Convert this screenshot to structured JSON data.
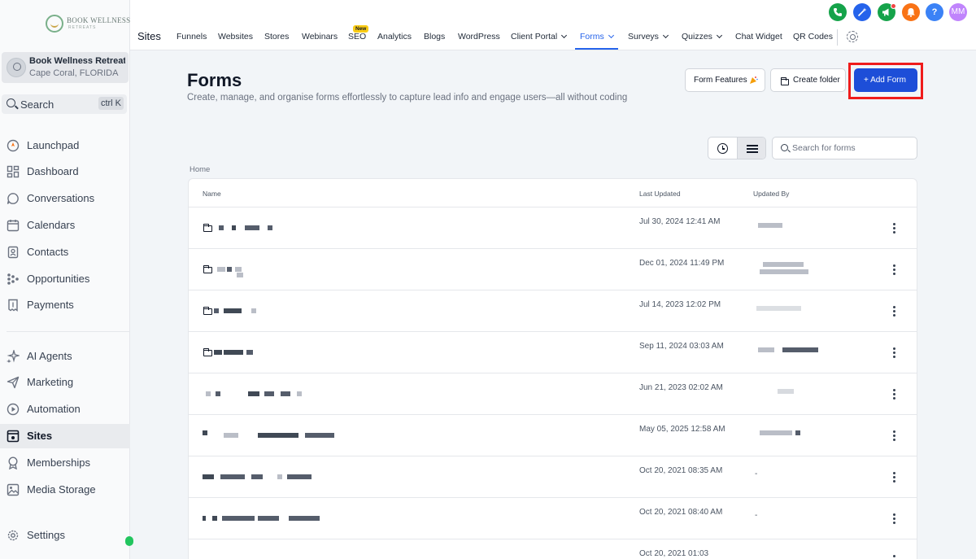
{
  "brand": {
    "logo_line1": "BOOK WELLNESS",
    "logo_line2": "RETREATS"
  },
  "account": {
    "name": "Book Wellness Retreats",
    "location": "Cape Coral, FLORIDA"
  },
  "sidebar_search": {
    "label": "Search",
    "shortcut": "ctrl K"
  },
  "sidebar": {
    "items": [
      {
        "id": "launchpad",
        "label": "Launchpad"
      },
      {
        "id": "dashboard",
        "label": "Dashboard"
      },
      {
        "id": "conversations",
        "label": "Conversations"
      },
      {
        "id": "calendars",
        "label": "Calendars"
      },
      {
        "id": "contacts",
        "label": "Contacts"
      },
      {
        "id": "opportunities",
        "label": "Opportunities"
      },
      {
        "id": "payments",
        "label": "Payments"
      },
      {
        "id": "ai-agents",
        "label": "AI Agents"
      },
      {
        "id": "marketing",
        "label": "Marketing"
      },
      {
        "id": "automation",
        "label": "Automation"
      },
      {
        "id": "sites",
        "label": "Sites",
        "active": true
      },
      {
        "id": "memberships",
        "label": "Memberships"
      },
      {
        "id": "media-storage",
        "label": "Media Storage"
      },
      {
        "id": "settings",
        "label": "Settings"
      }
    ]
  },
  "topnav": {
    "section_title": "Sites",
    "tabs": [
      {
        "label": "Funnels"
      },
      {
        "label": "Websites"
      },
      {
        "label": "Stores"
      },
      {
        "label": "Webinars"
      },
      {
        "label": "SEO",
        "badge": "New"
      },
      {
        "label": "Analytics"
      },
      {
        "label": "Blogs"
      },
      {
        "label": "WordPress"
      },
      {
        "label": "Client Portal",
        "dropdown": true
      },
      {
        "label": "Forms",
        "dropdown": true,
        "active": true
      },
      {
        "label": "Surveys",
        "dropdown": true
      },
      {
        "label": "Quizzes",
        "dropdown": true
      },
      {
        "label": "Chat Widget"
      },
      {
        "label": "QR Codes"
      }
    ],
    "seo_badge": "New"
  },
  "header_icons": {
    "phone_color": "#15a34a",
    "magic_color": "#2563eb",
    "announce_color": "#16a34a",
    "bell_color": "#f97316",
    "help_label": "?",
    "help_color": "#3b82f6",
    "avatar_initials": "MM",
    "avatar_color": "#c084fc"
  },
  "page": {
    "title": "Forms",
    "subtitle": "Create, manage, and organise forms effortlessly to capture lead info and engage users—all without coding",
    "buttons": {
      "form_features": "Form Features",
      "create_folder": "Create folder",
      "add_form": "+ Add Form"
    },
    "search_placeholder": "Search for forms",
    "breadcrumb": "Home"
  },
  "table": {
    "columns": {
      "name": "Name",
      "last_updated": "Last Updated",
      "updated_by": "Updated By"
    },
    "rows": [
      {
        "type": "folder",
        "last_updated": "Jul 30, 2024 12:41 AM",
        "updated_by": ""
      },
      {
        "type": "folder",
        "last_updated": "Dec 01, 2024 11:49 PM",
        "updated_by": ""
      },
      {
        "type": "folder",
        "last_updated": "Jul 14, 2023 12:02 PM",
        "updated_by": ""
      },
      {
        "type": "folder",
        "last_updated": "Sep 11, 2024 03:03 AM",
        "updated_by": ""
      },
      {
        "type": "form",
        "last_updated": "Jun 21, 2023 02:02 AM",
        "updated_by": ""
      },
      {
        "type": "form",
        "last_updated": "May 05, 2025 12:58 AM",
        "updated_by": ""
      },
      {
        "type": "form",
        "last_updated": "Oct 20, 2021 08:35 AM",
        "updated_by": "-"
      },
      {
        "type": "form",
        "last_updated": "Oct 20, 2021 08:40 AM",
        "updated_by": "-"
      },
      {
        "type": "form",
        "last_updated": "Oct 20, 2021 01:03",
        "updated_by": ""
      }
    ]
  }
}
